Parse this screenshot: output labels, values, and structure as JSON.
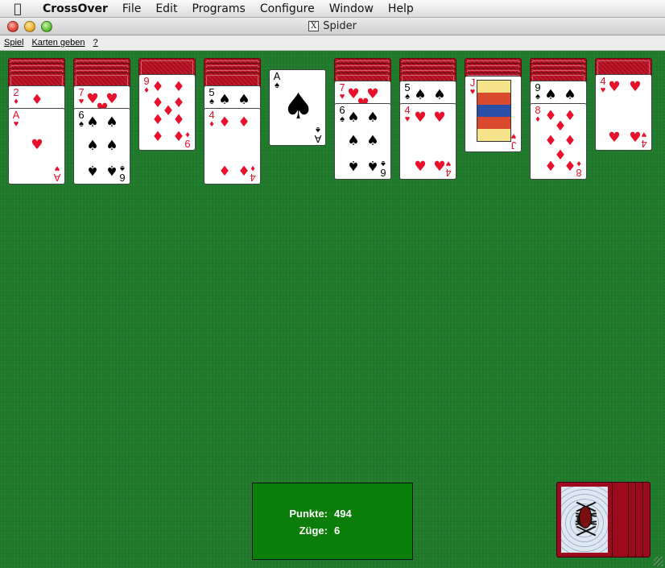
{
  "menubar": {
    "apple_icon": "apple-logo-icon",
    "app_name": "CrossOver",
    "items": [
      "File",
      "Edit",
      "Programs",
      "Configure",
      "Window",
      "Help"
    ]
  },
  "window": {
    "title_badge": "X",
    "title": "Spider"
  },
  "app_menu": {
    "items": [
      "Spiel",
      "Karten geben",
      "?"
    ]
  },
  "tableau": {
    "columns": [
      {
        "face_down": 4,
        "face_up": [
          "2♦",
          "A♥"
        ]
      },
      {
        "face_down": 4,
        "face_up": [
          "7♥",
          "6♠"
        ]
      },
      {
        "face_down": 1,
        "face_up": [
          "9♦"
        ]
      },
      {
        "face_down": 4,
        "face_up": [
          "5♠",
          "4♦"
        ]
      },
      {
        "face_down": 0,
        "face_up": [
          "A♠"
        ]
      },
      {
        "face_down": 4,
        "face_up": [
          "7♥",
          "6♠"
        ]
      },
      {
        "face_down": 4,
        "face_up": [
          "5♠",
          "4♥"
        ]
      },
      {
        "face_down": 4,
        "face_up": [
          "J♥"
        ]
      },
      {
        "face_down": 4,
        "face_up": [
          "9♠",
          "8♦"
        ]
      },
      {
        "face_down": 1,
        "face_up": [
          "4♥"
        ]
      }
    ]
  },
  "score": {
    "points_label": "Punkte:",
    "points": "494",
    "moves_label": "Züge:",
    "moves": "6"
  },
  "stock": {
    "remaining_deals": 5,
    "icon": "spider-web-card-back-icon"
  },
  "colors": {
    "felt": "#1f7a2c",
    "score_box": "#0b7d09",
    "card_back": "#a40d1e",
    "red_suit": "#e8102a"
  }
}
